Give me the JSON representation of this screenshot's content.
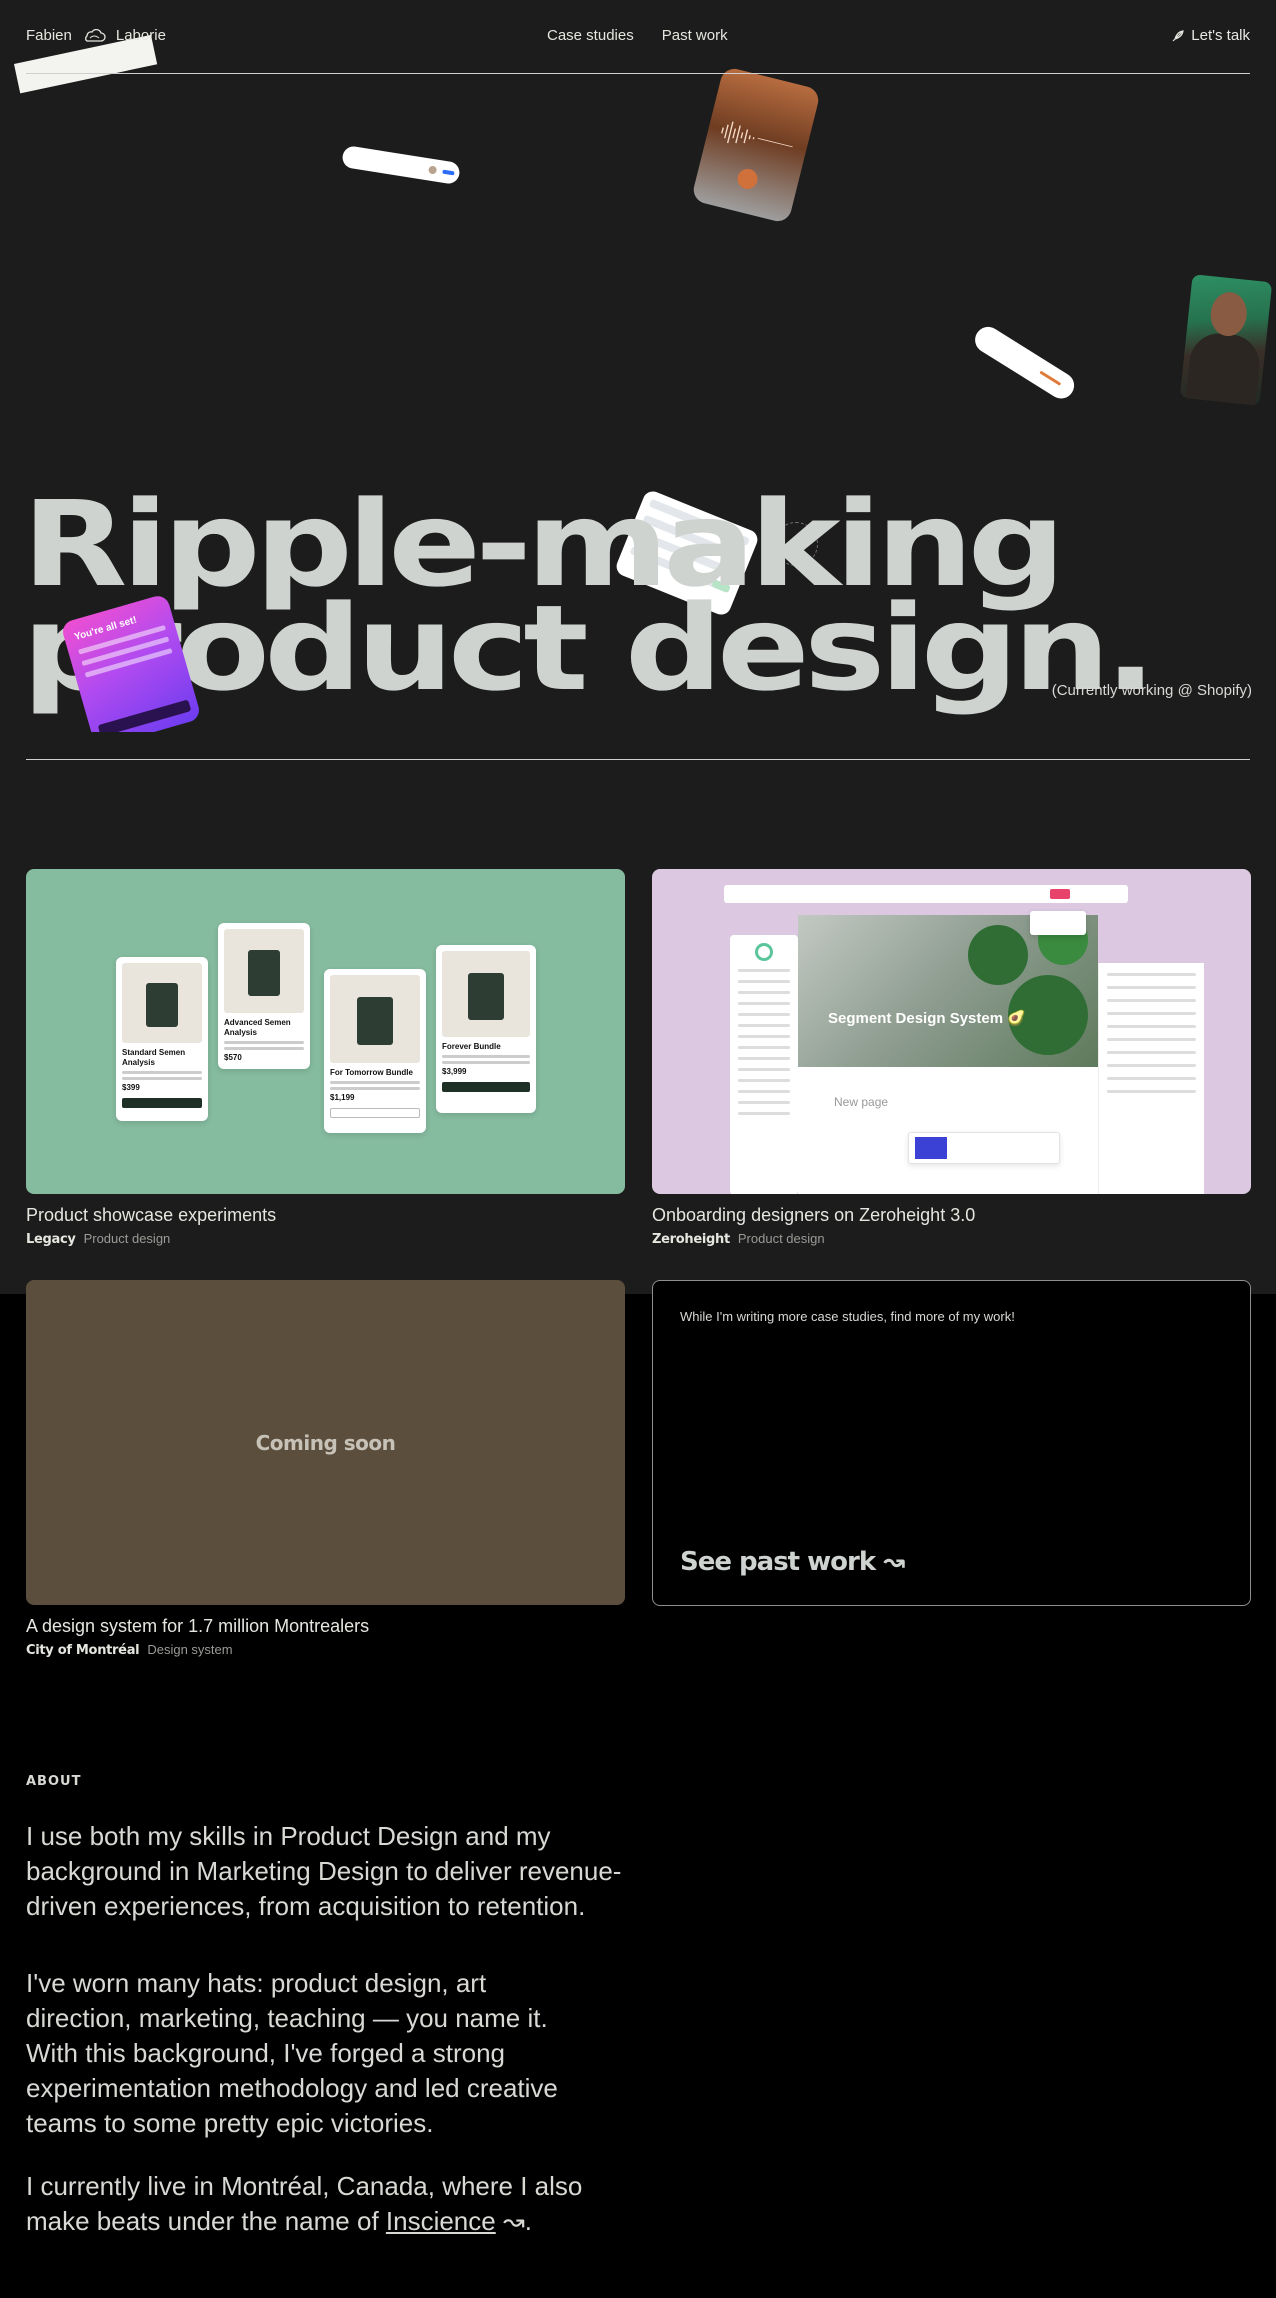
{
  "nav": {
    "name_first": "Fabien",
    "name_last": "Laborie",
    "links": [
      "Case studies",
      "Past work"
    ],
    "cta": "Let's talk"
  },
  "hero": {
    "headline_line1": "Ripple-making",
    "headline_line2": "product design.",
    "status": "(Currently working @ Shopify)"
  },
  "projects": [
    {
      "title": "Product showcase experiments",
      "company": "Legacy",
      "category": "Product design",
      "thumb_color": "#85bb9f"
    },
    {
      "title": "Onboarding designers on Zeroheight 3.0",
      "company": "Zeroheight",
      "category": "Product design",
      "thumb_color": "#dcc8e0",
      "thumb_heading": "Segment Design System 🥑",
      "thumb_subtext": "New page"
    },
    {
      "title": "A design system for 1.7 million Montrealers",
      "company": "City of Montréal",
      "category": "Design system",
      "thumb_label": "Coming soon",
      "thumb_color": "#5c4e3c"
    }
  ],
  "past_work": {
    "note": "While I'm writing more case studies, find more of my work!",
    "cta": "See past work ↝"
  },
  "showcase_cards": [
    {
      "title": "Standard Semen Analysis",
      "price": "$399"
    },
    {
      "title": "Advanced Semen Analysis",
      "price": "$570"
    },
    {
      "title": "For Tomorrow Bundle",
      "price": "$1,199"
    },
    {
      "title": "Forever Bundle",
      "price": "$3,999"
    }
  ],
  "about": {
    "label": "ABOUT",
    "p1": "I use both my skills in Product Design and my background in Marketing Design to deliver revenue-driven experiences, from acquisition to retention.",
    "p2": "I've worn many hats: product design, art direction, marketing, teaching — you name it. With this background,  I've forged a strong experimentation methodology and led creative teams to some pretty epic victories.",
    "p3_before": "I currently live in Montréal, Canada, where I also make beats under the name of ",
    "p3_link": "Inscience",
    "p3_after": " ↝."
  },
  "colors": {
    "hero_bg": "#1c1c1c",
    "page_bg": "#000000",
    "headline": "#cfd3cf",
    "accent_pink": "#e8436a"
  },
  "icons": {
    "logo": "cloud-icon",
    "cta": "quill-icon"
  }
}
